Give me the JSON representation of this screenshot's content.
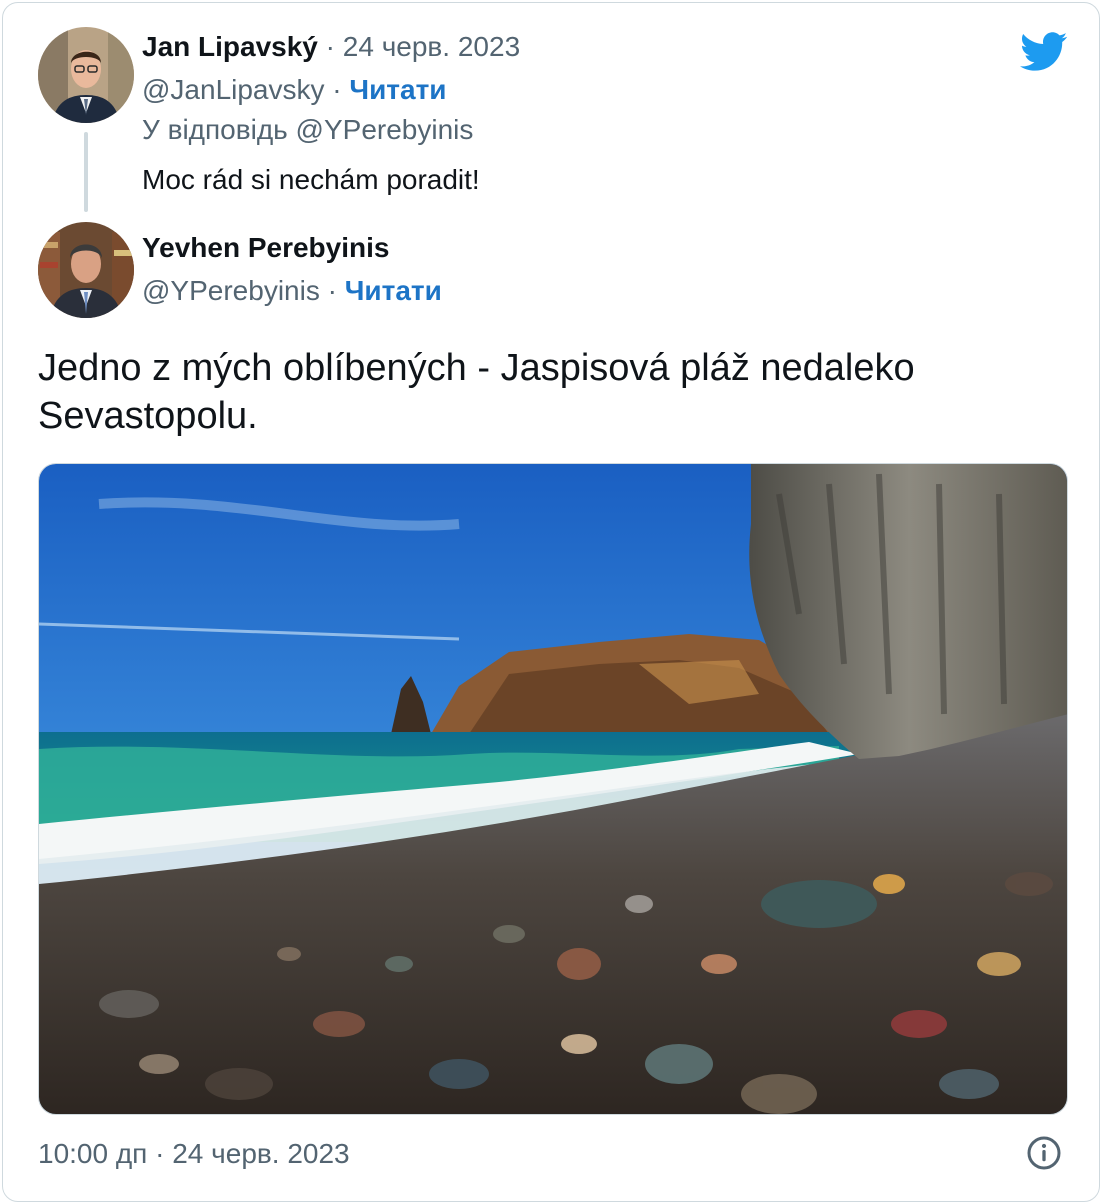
{
  "reply_tweet": {
    "author_name": "Jan Lipavský",
    "separator": "·",
    "date": "24 черв. 2023",
    "handle": "@JanLipavsky",
    "follow_label": "Читати",
    "reply_to_prefix": "У відповідь",
    "reply_to_handle": "@YPerebyinis",
    "text": "Moc rád si nechám poradit!"
  },
  "main_tweet": {
    "author_name": "Yevhen Perebyinis",
    "handle": "@YPerebyinis",
    "separator": "·",
    "follow_label": "Читати",
    "text": "Jedno z mých oblíbených - Jaspisová pláž nedaleko Sevastopolu.",
    "timestamp": "10:00 дп · 24 черв. 2023"
  },
  "icons": {
    "brand": "twitter-bird-icon",
    "info": "info-icon"
  },
  "colors": {
    "link": "#1d74c6",
    "brand": "#1d9bf0",
    "muted": "#536471",
    "text": "#0f1419",
    "border": "#cfd9de"
  }
}
